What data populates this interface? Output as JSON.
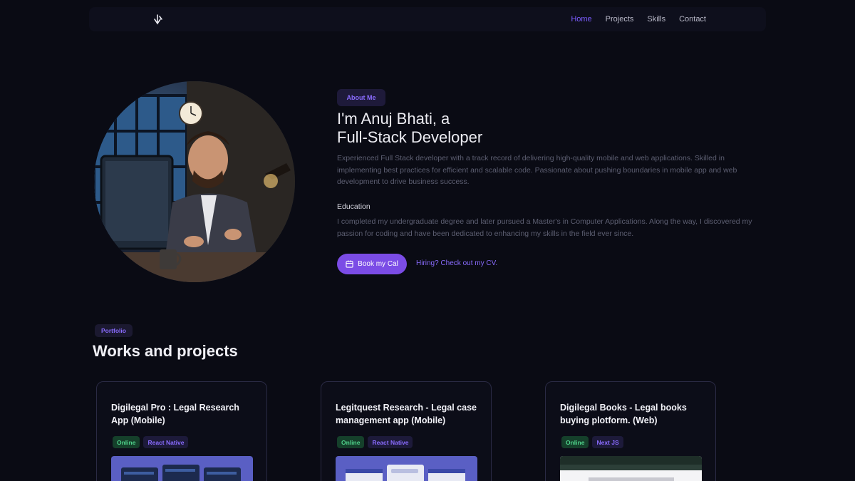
{
  "nav": {
    "links": [
      "Home",
      "Projects",
      "Skills",
      "Contact"
    ],
    "active": "Home"
  },
  "hero": {
    "badge": "About Me",
    "title_line1": "I'm Anuj Bhati, a",
    "title_line2": "Full-Stack Developer",
    "description": "Experienced Full Stack developer with a track record of delivering high-quality mobile and web applications. Skilled in implementing best practices for efficient and scalable code. Passionate about pushing boundaries in mobile app and web development to drive business success.",
    "education_title": "Education",
    "education_desc": "I completed my undergraduate degree and later pursued a Master's in Computer Applications. Along the way, I discovered my passion for coding and have been dedicated to enhancing my skills in the field ever since.",
    "cal_button": "Book my Cal",
    "cv_link": "Hiring? Check out my CV."
  },
  "portfolio": {
    "badge": "Portfolio",
    "title": "Works and projects",
    "cards": [
      {
        "title": "Digilegal Pro : Legal Research App (Mobile)",
        "status": "Online",
        "tech": "React Native"
      },
      {
        "title": "Legitquest Research - Legal case management app (Mobile)",
        "status": "Online",
        "tech": "React Native"
      },
      {
        "title": "Digilegal Books - Legal books buying plotform. (Web)",
        "status": "Online",
        "tech": "Next JS"
      }
    ]
  },
  "colors": {
    "background": "#0a0b14",
    "accent": "#7b4ce6",
    "status_online": "#4fd08a"
  },
  "icons": [
    "logo-icon",
    "calendar-icon"
  ]
}
